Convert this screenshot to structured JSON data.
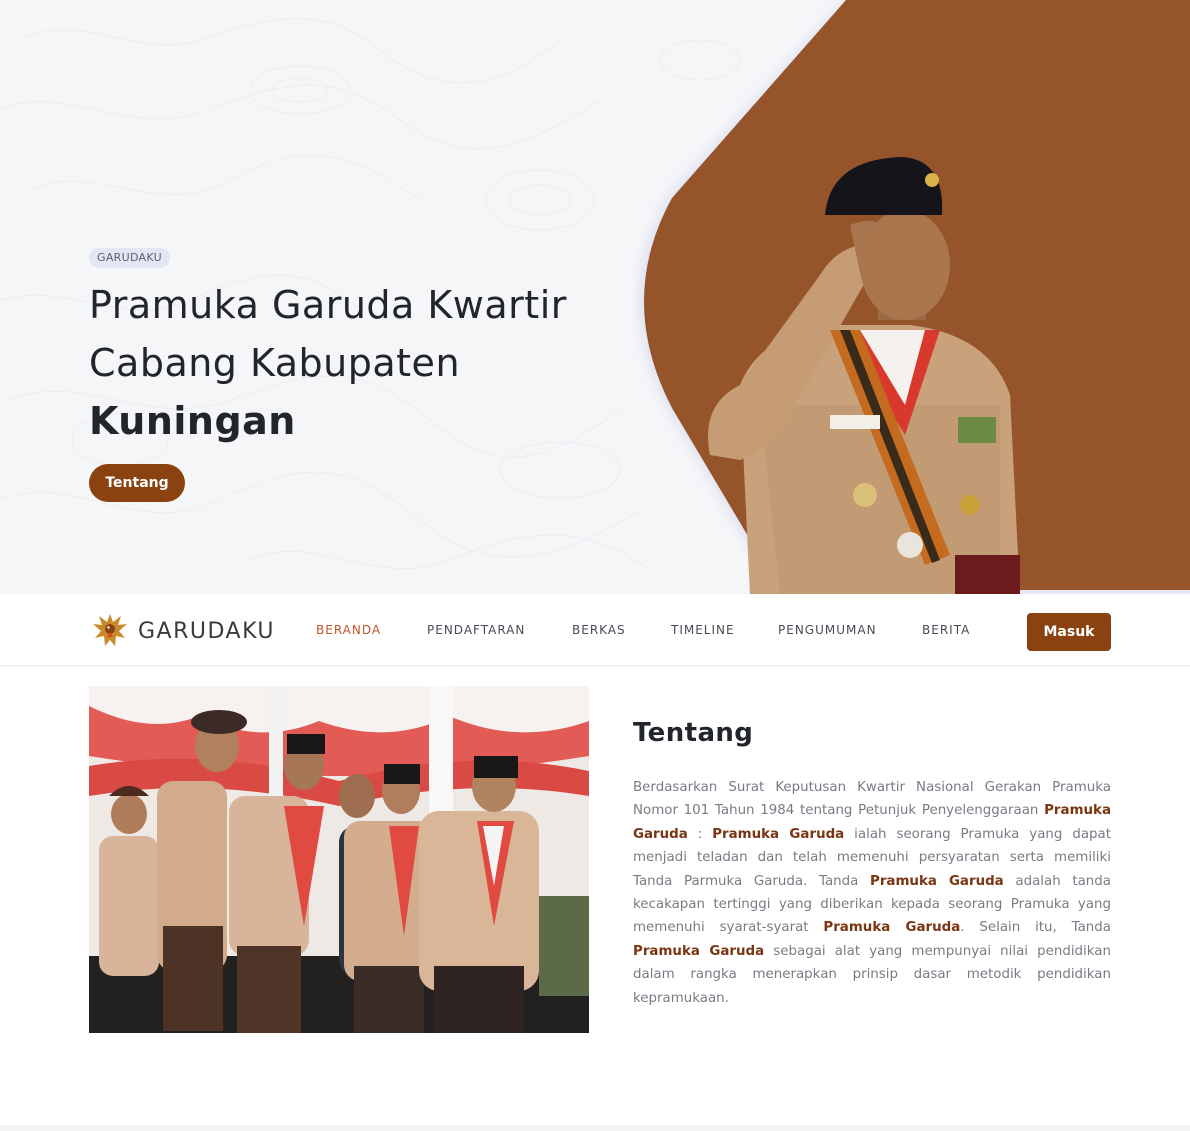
{
  "colors": {
    "accent": "#8a4210",
    "hero_shape": "#95542a",
    "nav_active": "#c0562a",
    "highlight": "#7a3512"
  },
  "hero": {
    "badge": "GARUDAKU",
    "title_line1": "Pramuka Garuda Kwartir",
    "title_line2": "Cabang Kabupaten",
    "title_line3": "Kuningan",
    "button": "Tentang"
  },
  "navbar": {
    "brand": "GARUDAKU",
    "items": [
      {
        "label": "BERANDA",
        "active": true
      },
      {
        "label": "PENDAFTARAN",
        "active": false
      },
      {
        "label": "BERKAS",
        "active": false
      },
      {
        "label": "TIMELINE",
        "active": false
      },
      {
        "label": "PENGUMUMAN",
        "active": false
      },
      {
        "label": "BERITA",
        "active": false
      }
    ],
    "login": "Masuk"
  },
  "about": {
    "title": "Tentang",
    "p1": "Berdasarkan Surat Keputusan Kwartir Nasional Gerakan Pramuka Nomor 101 Tahun 1984 tentang Petunjuk Penyelenggaraan ",
    "h1": "Pramuka Garuda",
    "p2": " : ",
    "h2": "Pramuka Garuda",
    "p3": " ialah seorang Pramuka yang dapat menjadi teladan dan telah memenuhi persyaratan serta memiliki Tanda Parmuka Garuda. Tanda ",
    "h3": "Pramuka Garuda",
    "p4": " adalah tanda kecakapan tertinggi yang diberikan kepada seorang Pramuka yang memenuhi syarat-syarat ",
    "h4": "Pramuka Garuda",
    "p5": ". Selain itu, Tanda ",
    "h5": "Pramuka Garuda",
    "p6": " sebagai alat yang mempunyai nilai pendidikan dalam rangka menerapkan prinsip dasar metodik pendidikan kepramukaan."
  },
  "icons": {
    "brand_logo": "garuda-logo-icon"
  }
}
